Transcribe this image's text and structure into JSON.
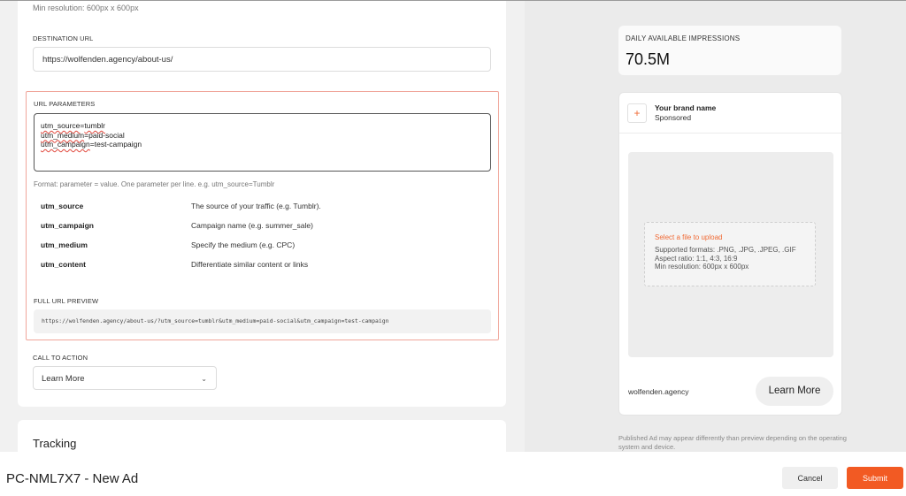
{
  "creative": {
    "min_resolution": "Min resolution: 600px x 600px"
  },
  "destination": {
    "label": "DESTINATION URL",
    "value": "https://wolfenden.agency/about-us/"
  },
  "url_params": {
    "label": "URL PARAMETERS",
    "lines": [
      {
        "key": "utm_source",
        "value": "=tumblr"
      },
      {
        "key": "utm_medium",
        "value": "=paid-social"
      },
      {
        "key": "utm_campaign",
        "value": "=test-campaign"
      }
    ],
    "misspelled": {
      "line0": "tumblr"
    },
    "format_hint": "Format: parameter = value. One parameter per line. e.g. utm_source=Tumblr",
    "reference": [
      {
        "key": "utm_source",
        "desc": "The source of your traffic (e.g. Tumblr)."
      },
      {
        "key": "utm_campaign",
        "desc": "Campaign name (e.g. summer_sale)"
      },
      {
        "key": "utm_medium",
        "desc": "Specify the medium (e.g. CPC)"
      },
      {
        "key": "utm_content",
        "desc": "Differentiate similar content or links"
      }
    ],
    "preview_label": "FULL URL PREVIEW",
    "preview_value": "https://wolfenden.agency/about-us/?utm_source=tumblr&utm_medium=paid-social&utm_campaign=test-campaign"
  },
  "cta": {
    "label": "CALL TO ACTION",
    "selected": "Learn More",
    "chevron_icon": "chevron-down-icon"
  },
  "tracking": {
    "title": "Tracking"
  },
  "impressions": {
    "label": "DAILY AVAILABLE IMPRESSIONS",
    "value": "70.5M"
  },
  "ad_preview": {
    "brand_name": "Your brand name",
    "sponsored": "Sponsored",
    "plus_icon": "+",
    "upload_link": "Select a file to upload",
    "upload_formats": "Supported formats: .PNG, .JPG, .JPEG, .GIF",
    "upload_aspect": "Aspect ratio: 1:1, 4:3, 16:9",
    "upload_resolution": "Min resolution: 600px x 600px",
    "domain": "wolfenden.agency",
    "button": "Learn More"
  },
  "disclaimer": "Published Ad may appear differently than preview depending on the operating system and device.",
  "footer": {
    "title": "PC-NML7X7 - New Ad",
    "cancel": "Cancel",
    "submit": "Submit"
  },
  "colors": {
    "accent": "#f25a23",
    "highlight_border": "#f0a59a"
  }
}
